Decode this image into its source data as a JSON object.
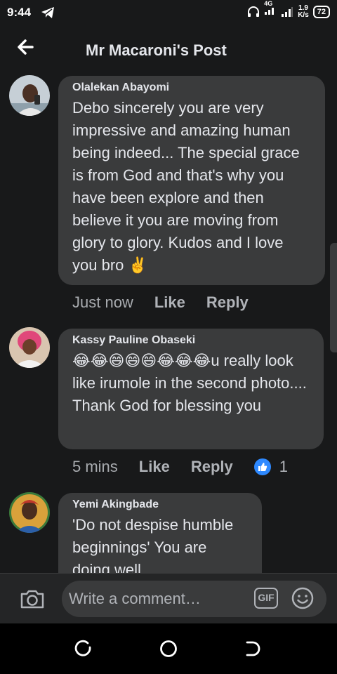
{
  "status_bar": {
    "time": "9:44",
    "network": "4G",
    "speed_value": "1.9",
    "speed_unit": "K/s",
    "battery": "72"
  },
  "header": {
    "title": "Mr Macaroni's Post"
  },
  "comments": [
    {
      "author": "Olalekan Abayomi",
      "text": "Debo sincerely you are very impressive and amazing human being indeed... The special grace is from God and that's why you have been explore and then believe it you are moving from glory to glory. Kudos and I love you bro ✌️",
      "time": "Just now",
      "like_label": "Like",
      "reply_label": "Reply"
    },
    {
      "author": "Kassy Pauline Obaseki",
      "text": "😂😂😄😄😄😂😂😂u really look like irumole in the second photo.... Thank God for blessing you",
      "time": "5 mins",
      "like_label": "Like",
      "reply_label": "Reply",
      "reaction_count": "1"
    },
    {
      "author": "Yemi Akingbade",
      "text": "'Do not despise humble beginnings' You are doing well"
    }
  ],
  "composer": {
    "placeholder": "Write a comment…",
    "gif_label": "GIF"
  },
  "colors": {
    "background": "#18191a",
    "bubble": "#3a3b3c",
    "like_blue": "#2e89ff"
  }
}
